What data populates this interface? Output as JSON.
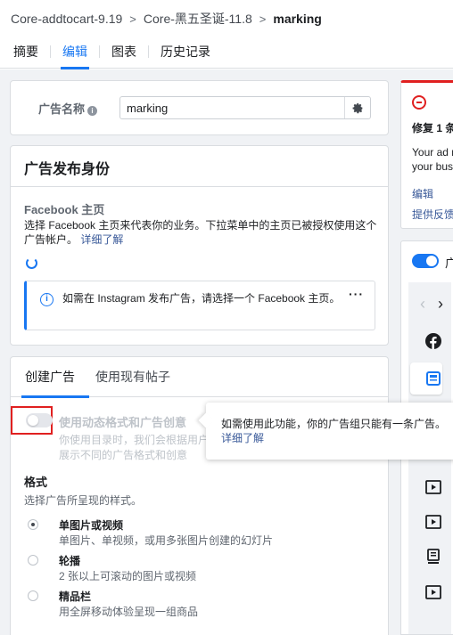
{
  "breadcrumb": {
    "campaign": "Core-addtocart-9.19",
    "adset": "Core-黑五圣诞-11.8",
    "ad": "marking"
  },
  "tabs": [
    {
      "label": "摘要"
    },
    {
      "label": "编辑"
    },
    {
      "label": "图表"
    },
    {
      "label": "历史记录"
    }
  ],
  "ad_name": {
    "label": "广告名称",
    "value": "marking"
  },
  "identity": {
    "title": "广告发布身份",
    "facebook_page_label": "Facebook 主页",
    "facebook_page_desc": "选择 Facebook 主页来代表你的业务。下拉菜单中的主页已被授权使用这个广告帐户。",
    "learn_more": "详细了解",
    "instagram_notice": "如需在 Instagram 发布广告，请选择一个 Facebook 主页。"
  },
  "creative": {
    "tab_create": "创建广告",
    "tab_existing": "使用现有帖子",
    "dynamic_title": "使用动态格式和广告创意",
    "dynamic_desc": "你使用目录时，我们会根据用户展示不同的广告格式和创意",
    "dynamic_enabled": false,
    "format_label": "格式",
    "format_desc": "选择广告所呈现的样式。",
    "options": [
      {
        "title": "单图片或视频",
        "desc": "单图片、单视频，或用多张图片创建的幻灯片",
        "selected": true
      },
      {
        "title": "轮播",
        "desc": "2 张以上可滚动的图片或视频",
        "selected": false
      },
      {
        "title": "精品栏",
        "desc": "用全屏移动体验呈现一组商品",
        "selected": false
      }
    ]
  },
  "tooltip": {
    "text": "如需使用此功能，你的广告组只能有一条广告。",
    "link": "详细了解"
  },
  "error_panel": {
    "title": "修复 1 条",
    "body_line1": "Your ad n",
    "body_line2": "your bus",
    "edit_link": "编辑",
    "feedback_link": "提供反馈"
  },
  "preview": {
    "toggle_on": true,
    "label": "广",
    "icons": [
      "facebook-icon",
      "feed-icon",
      "video-icon",
      "video-icon",
      "story-icon",
      "video-icon"
    ]
  },
  "colors": {
    "accent": "#1877f2",
    "error": "#e02020",
    "link": "#385898"
  }
}
